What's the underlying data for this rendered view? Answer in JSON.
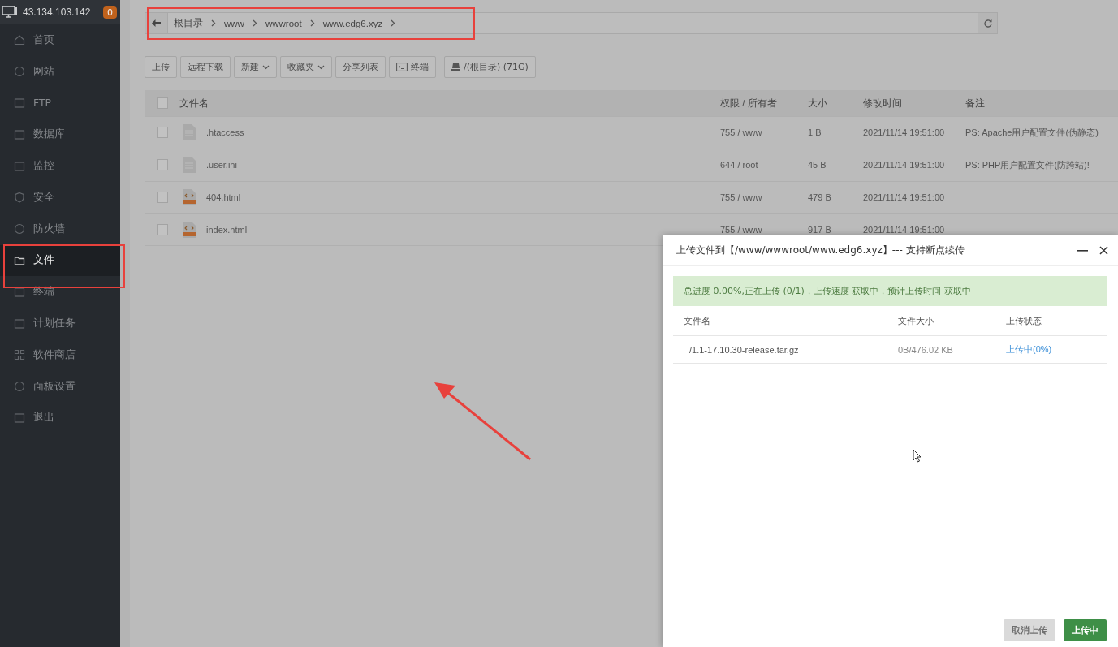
{
  "server": {
    "ip": "43.134.103.142",
    "badge": "0"
  },
  "sidebar": {
    "items": [
      {
        "label": "首页",
        "selected": false
      },
      {
        "label": "网站",
        "selected": false
      },
      {
        "label": "FTP",
        "selected": false
      },
      {
        "label": "数据库",
        "selected": false
      },
      {
        "label": "监控",
        "selected": false
      },
      {
        "label": "安全",
        "selected": false
      },
      {
        "label": "防火墙",
        "selected": false
      },
      {
        "label": "文件",
        "selected": true
      },
      {
        "label": "终端",
        "selected": false
      },
      {
        "label": "计划任务",
        "selected": false
      },
      {
        "label": "软件商店",
        "selected": false
      },
      {
        "label": "面板设置",
        "selected": false
      },
      {
        "label": "退出",
        "selected": false
      }
    ]
  },
  "breadcrumb": [
    "根目录",
    "www",
    "wwwroot",
    "www.edg6.xyz"
  ],
  "toolbar": [
    {
      "label": "上传",
      "kind": "plain"
    },
    {
      "label": "远程下载",
      "kind": "plain"
    },
    {
      "label": "新建",
      "kind": "dropdown"
    },
    {
      "label": "收藏夹",
      "kind": "dropdown"
    },
    {
      "label": "分享列表",
      "kind": "plain"
    },
    {
      "label": "终端",
      "kind": "terminal"
    },
    {
      "label": "/(根目录) (71G)",
      "kind": "disk"
    }
  ],
  "table": {
    "select_all": {
      "checked": false
    },
    "columns": [
      "文件名",
      "权限 / 所有者",
      "大小",
      "修改时间",
      "备注"
    ],
    "rows": [
      {
        "name": ".htaccess",
        "kind": "text",
        "checked": false,
        "permission": "755 / www",
        "size": "1 B",
        "modified": "2021/11/14 19:51:00",
        "note": "PS: Apache用户配置文件(伪静态)"
      },
      {
        "name": ".user.ini",
        "kind": "text",
        "checked": false,
        "permission": "644 / root",
        "size": "45 B",
        "modified": "2021/11/14 19:51:00",
        "note": "PS: PHP用户配置文件(防跨站)!"
      },
      {
        "name": "404.html",
        "kind": "html",
        "checked": false,
        "permission": "755 / www",
        "size": "479 B",
        "modified": "2021/11/14 19:51:00"
      },
      {
        "name": "index.html",
        "kind": "html",
        "checked": false,
        "permission": "755 / www",
        "size": "917 B",
        "modified": "2021/11/14 19:51:00"
      }
    ]
  },
  "upload_dialog": {
    "title": "上传文件到【/www/wwwroot/www.edg6.xyz】--- 支持断点续传",
    "progress": "总进度 0.00%,正在上传 (0/1)，上传速度 获取中，预计上传时间 获取中",
    "columns": [
      "文件名",
      "文件大小",
      "上传状态"
    ],
    "files": [
      {
        "name": "/1.1-17.10.30-release.tar.gz",
        "size": "0B/476.02 KB",
        "status": "上传中(0%)"
      }
    ],
    "buttons": [
      {
        "label": "取消上传",
        "disabled": true
      },
      {
        "label": "上传中",
        "disabled": false
      }
    ]
  }
}
